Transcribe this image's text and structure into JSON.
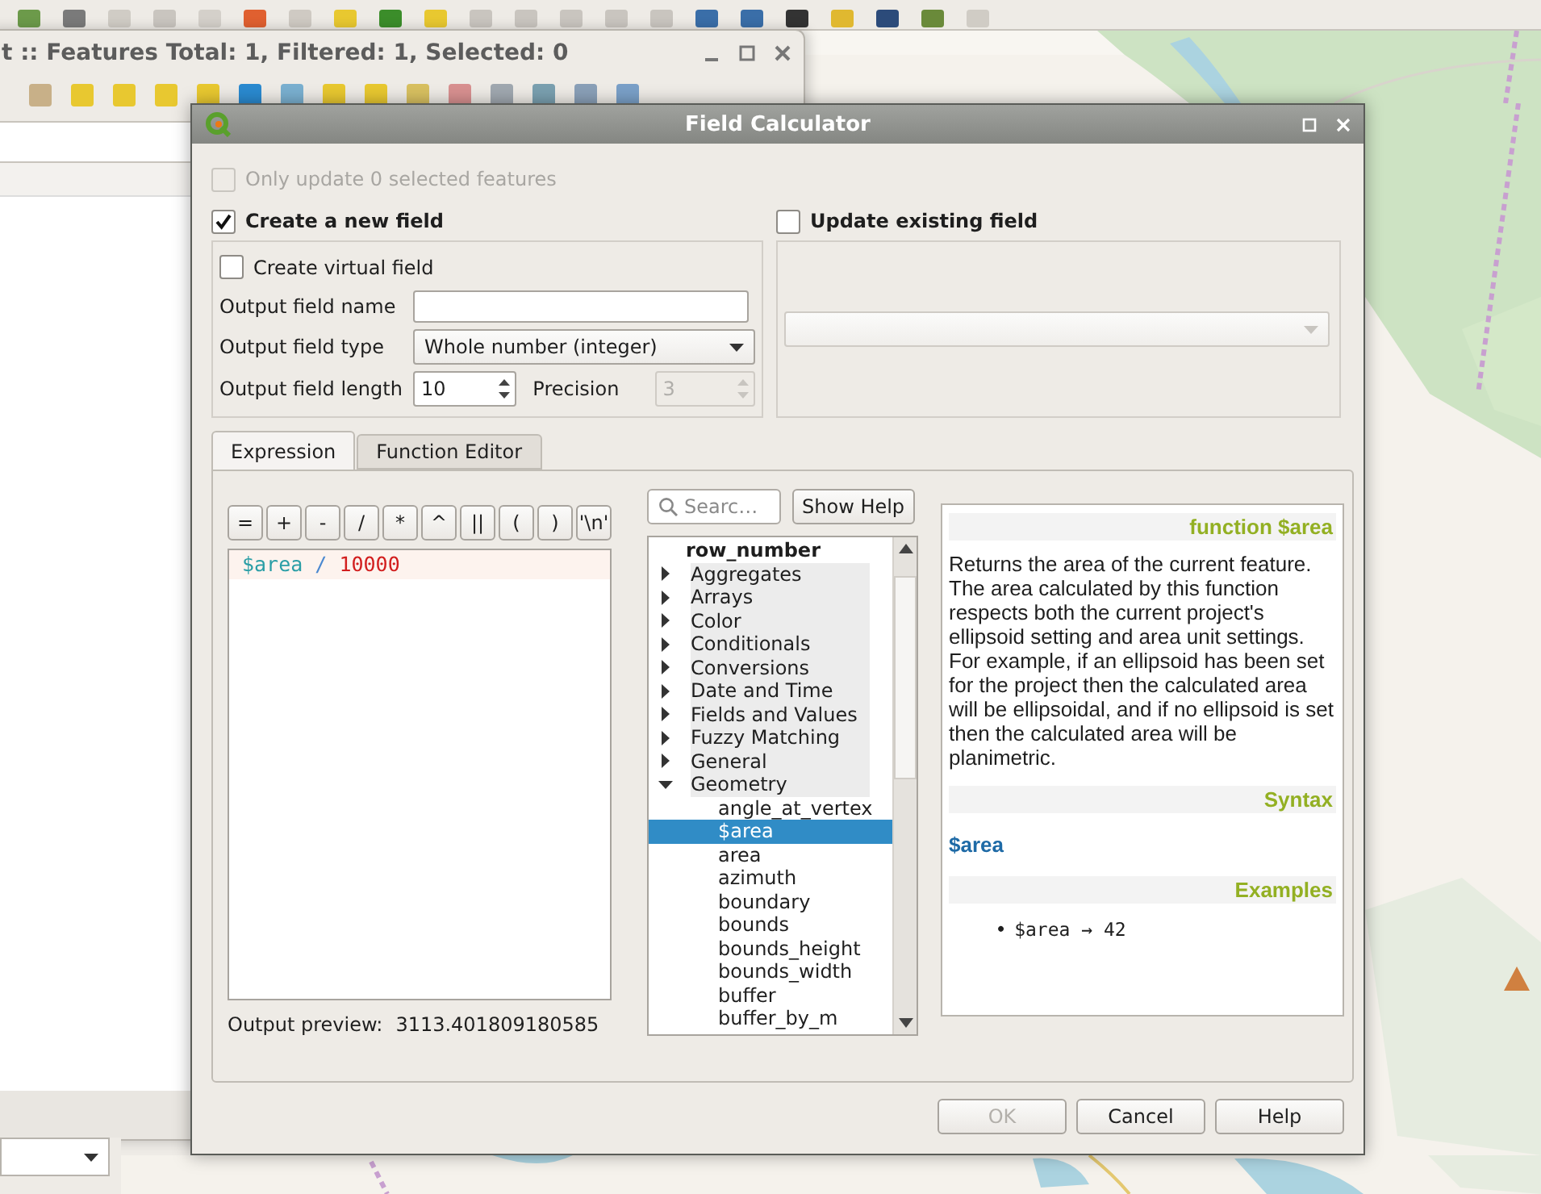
{
  "attribute_window": {
    "title": "t :: Features Total: 1, Filtered: 1, Selected: 0"
  },
  "dialog": {
    "title": "Field Calculator"
  },
  "only_update": {
    "label": "Only update 0 selected features",
    "checked": false,
    "disabled": true
  },
  "new_field": {
    "label": "Create a new field",
    "checked": true,
    "virtual_field": {
      "label": "Create virtual field",
      "checked": false
    },
    "name": {
      "label": "Output field name"
    },
    "type": {
      "label": "Output field type",
      "value": "Whole number (integer)"
    },
    "length": {
      "label": "Output field length",
      "value": "10"
    },
    "precision": {
      "label": "Precision",
      "value": "3",
      "disabled": true
    }
  },
  "update_field": {
    "label": "Update existing field",
    "checked": false
  },
  "tabs": [
    {
      "label": "Expression",
      "selected": true
    },
    {
      "label": "Function Editor",
      "selected": false
    }
  ],
  "operators": [
    "=",
    "+",
    "-",
    "/",
    "*",
    "^",
    "||",
    "(",
    ")",
    "'\\n'"
  ],
  "expression": [
    {
      "text": "$area",
      "kind": "variable"
    },
    {
      "text": "/",
      "kind": "operator"
    },
    {
      "text": "10000",
      "kind": "number"
    }
  ],
  "output_preview": {
    "label": "Output preview:",
    "value": "3113.401809180585"
  },
  "search": {
    "placeholder": "Searc…"
  },
  "show_help_button": "Show Help",
  "function_tree": [
    {
      "label": "row_number",
      "kind": "item",
      "selected": false
    },
    {
      "label": "Aggregates",
      "kind": "group",
      "expanded": false,
      "selected": false
    },
    {
      "label": "Arrays",
      "kind": "group",
      "expanded": false,
      "selected": false
    },
    {
      "label": "Color",
      "kind": "group",
      "expanded": false,
      "selected": false
    },
    {
      "label": "Conditionals",
      "kind": "group",
      "expanded": false,
      "selected": false
    },
    {
      "label": "Conversions",
      "kind": "group",
      "expanded": false,
      "selected": false
    },
    {
      "label": "Date and Time",
      "kind": "group",
      "expanded": false,
      "selected": false
    },
    {
      "label": "Fields and Values",
      "kind": "group",
      "expanded": false,
      "selected": false
    },
    {
      "label": "Fuzzy Matching",
      "kind": "group",
      "expanded": false,
      "selected": false
    },
    {
      "label": "General",
      "kind": "group",
      "expanded": false,
      "selected": false
    },
    {
      "label": "Geometry",
      "kind": "group",
      "expanded": true,
      "selected": false,
      "children": [
        {
          "label": "angle_at_vertex",
          "selected": false
        },
        {
          "label": "$area",
          "selected": true
        },
        {
          "label": "area",
          "selected": false
        },
        {
          "label": "azimuth",
          "selected": false
        },
        {
          "label": "boundary",
          "selected": false
        },
        {
          "label": "bounds",
          "selected": false
        },
        {
          "label": "bounds_height",
          "selected": false
        },
        {
          "label": "bounds_width",
          "selected": false
        },
        {
          "label": "buffer",
          "selected": false
        },
        {
          "label": "buffer_by_m",
          "selected": false
        }
      ]
    }
  ],
  "help": {
    "title": "function $area",
    "description": "Returns the area of the current feature. The area calculated by this function respects both the current project's ellipsoid setting and area unit settings. For example, if an ellipsoid has been set for the project then the calculated area will be ellipsoidal, and if no ellipsoid is set then the calculated area will be planimetric.",
    "syntax_heading": "Syntax",
    "syntax": "$area",
    "examples_heading": "Examples",
    "examples": [
      {
        "bullet": "•",
        "text": "$area → 42"
      }
    ]
  },
  "buttons": [
    {
      "label": "OK",
      "disabled": true
    },
    {
      "label": "Cancel",
      "disabled": false
    },
    {
      "label": "Help",
      "disabled": false
    }
  ]
}
